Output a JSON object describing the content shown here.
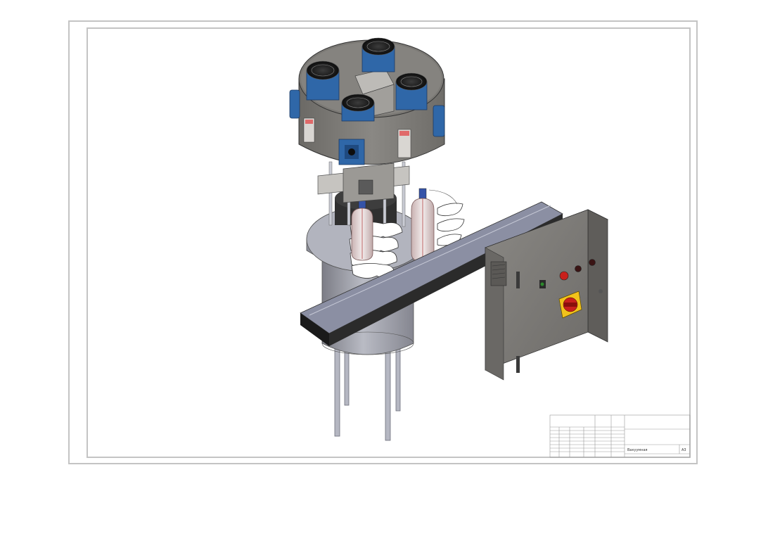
{
  "drawing": {
    "kind": "CAD assembly drawing sheet",
    "colors": {
      "frame": "#c4c4c4",
      "housing": "#787673",
      "motor_blue": "#2f67a8",
      "conveyor_top": "#8b8fa3",
      "cabinet": "#7a7874",
      "switch_yellow": "#f2c21b",
      "button_red": "#c8201c"
    }
  },
  "title_block": {
    "drawing_name": "Вакуумная",
    "sheet_format": "А3"
  }
}
